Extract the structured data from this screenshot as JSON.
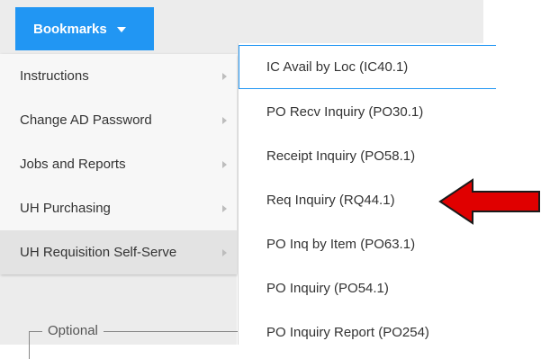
{
  "header": {
    "bookmarks_label": "Bookmarks"
  },
  "menu": {
    "items": [
      {
        "label": "Instructions"
      },
      {
        "label": "Change AD Password"
      },
      {
        "label": "Jobs and Reports"
      },
      {
        "label": "UH Purchasing"
      },
      {
        "label": "UH Requisition Self-Serve"
      }
    ],
    "active_index": 4
  },
  "fieldset": {
    "legend": "Optional"
  },
  "submenu": {
    "items": [
      {
        "label": "IC Avail by Loc (IC40.1)"
      },
      {
        "label": "PO Recv Inquiry (PO30.1)"
      },
      {
        "label": "Receipt Inquiry (PO58.1)"
      },
      {
        "label": "Req Inquiry (RQ44.1)"
      },
      {
        "label": "PO Inq by Item (PO63.1)"
      },
      {
        "label": "PO Inquiry (PO54.1)"
      },
      {
        "label": "PO Inquiry Report (PO254)"
      }
    ],
    "focused_index": 0
  },
  "colors": {
    "accent": "#2196f3",
    "annotation_arrow": "#e00000"
  },
  "icons": {
    "caret": "caret-down-icon",
    "submenu_chevron": "chevron-right-icon",
    "annotation": "red-arrow-left-icon"
  }
}
